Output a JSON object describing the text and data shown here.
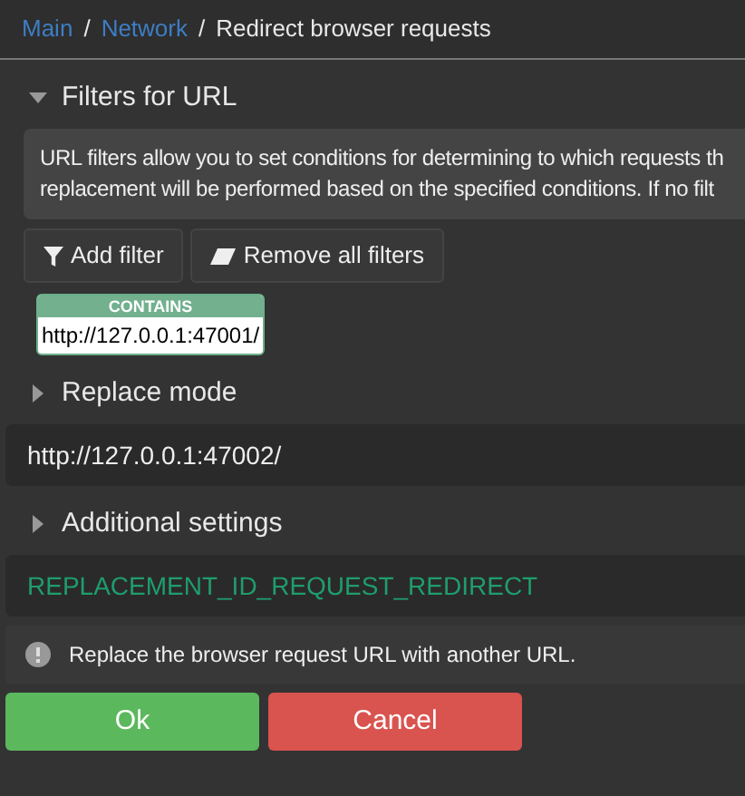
{
  "breadcrumb": [
    {
      "label": "Main",
      "kind": "link"
    },
    {
      "label": "/",
      "kind": "separator"
    },
    {
      "label": "Network",
      "kind": "link"
    },
    {
      "label": "/",
      "kind": "separator"
    },
    {
      "label": "Redirect browser requests",
      "kind": "current"
    }
  ],
  "filters_section": {
    "title": "Filters for URL",
    "expanded": true,
    "description": "URL filters allow you to set conditions for determining to which requests th\nreplacement will be performed based on the specified conditions. If no filt",
    "buttons": [
      {
        "label": "Add filter",
        "kind": "add"
      },
      {
        "label": "Remove all filters",
        "kind": "remove"
      }
    ],
    "filters": [
      {
        "type": "CONTAINS",
        "value": "http://127.0.0.1:47001/"
      }
    ]
  },
  "replace_mode_section": {
    "title": "Replace mode",
    "expanded": false,
    "value": "http://127.0.0.1:47002/"
  },
  "additional_section": {
    "title": "Additional settings",
    "expanded": false,
    "value": "REPLACEMENT_ID_REQUEST_REDIRECT"
  },
  "hint": "Replace the browser request URL with another URL.",
  "actions": [
    {
      "label": "Ok",
      "kind": "ok"
    },
    {
      "label": "Cancel",
      "kind": "cancel"
    }
  ]
}
